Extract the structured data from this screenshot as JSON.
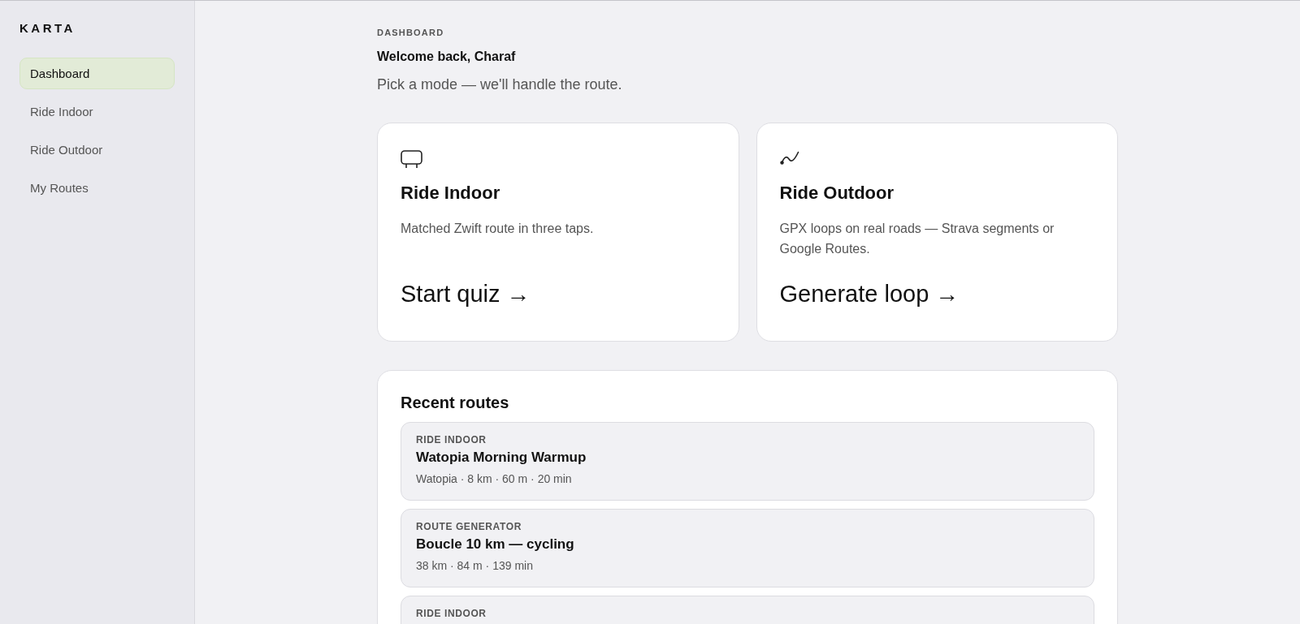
{
  "sidebar": {
    "brand": "KARTA",
    "items": [
      {
        "label": "Dashboard",
        "selected": true
      },
      {
        "label": "Ride Indoor",
        "selected": false
      },
      {
        "label": "Ride Outdoor",
        "selected": false
      },
      {
        "label": "My Routes",
        "selected": false
      }
    ]
  },
  "header": {
    "eyebrow": "DASHBOARD",
    "greeting": "Welcome back, Charaf",
    "subtitle": "Pick a mode — we'll handle the route."
  },
  "mode_cards": [
    {
      "kind": "indoor",
      "title": "Ride Indoor",
      "description": "Matched Zwift route in three taps.",
      "action": "Start quiz →"
    },
    {
      "kind": "outdoor",
      "title": "Ride Outdoor",
      "description": "GPX loops on real roads — Strava segments or Google Routes.",
      "action": "Generate loop →"
    }
  ],
  "recent_routes": {
    "title": "Recent routes",
    "items": [
      {
        "category": "RIDE INDOOR",
        "name": "Watopia Morning Warmup",
        "meta": "Watopia · 8 km · 60 m · 20 min"
      },
      {
        "category": "ROUTE GENERATOR",
        "name": "Boucle 10 km — cycling",
        "meta": "38 km · 84 m · 139 min"
      },
      {
        "category": "RIDE INDOOR"
      }
    ]
  }
}
